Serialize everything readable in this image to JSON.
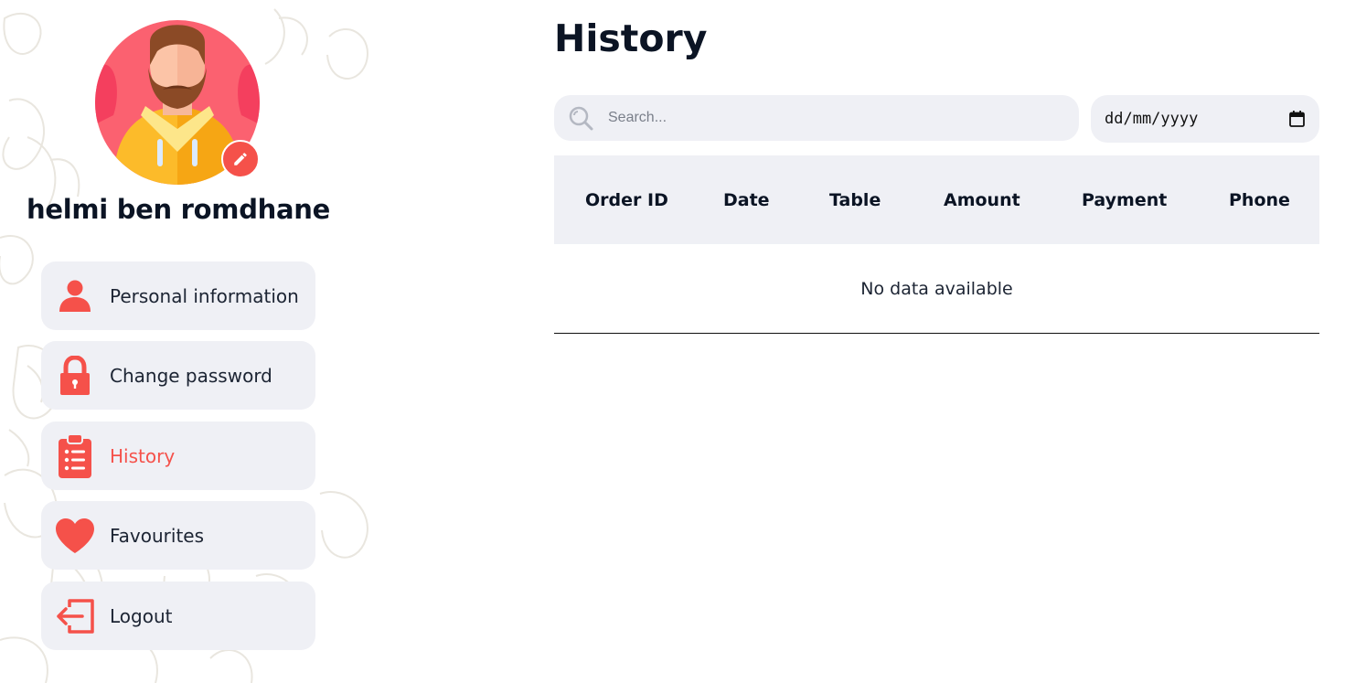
{
  "profile": {
    "name": "helmi ben romdhane"
  },
  "sidebar": {
    "items": [
      {
        "label": "Personal information",
        "icon": "user-icon",
        "active": false
      },
      {
        "label": "Change password",
        "icon": "lock-icon",
        "active": false
      },
      {
        "label": "History",
        "icon": "clipboard-list-icon",
        "active": true
      },
      {
        "label": "Favourites",
        "icon": "heart-icon",
        "active": false
      },
      {
        "label": "Logout",
        "icon": "logout-icon",
        "active": false
      }
    ]
  },
  "main": {
    "title": "History",
    "search": {
      "placeholder": "Search...",
      "value": ""
    },
    "date_filter": {
      "placeholder": "dd/mm/yyyy"
    },
    "table": {
      "columns": [
        "Order ID",
        "Date",
        "Table",
        "Amount",
        "Payment",
        "Phone"
      ],
      "rows": [],
      "empty_text": "No data available"
    }
  },
  "colors": {
    "accent": "#f5514a",
    "panel": "#eff0f5",
    "text_dark": "#0b1424"
  }
}
